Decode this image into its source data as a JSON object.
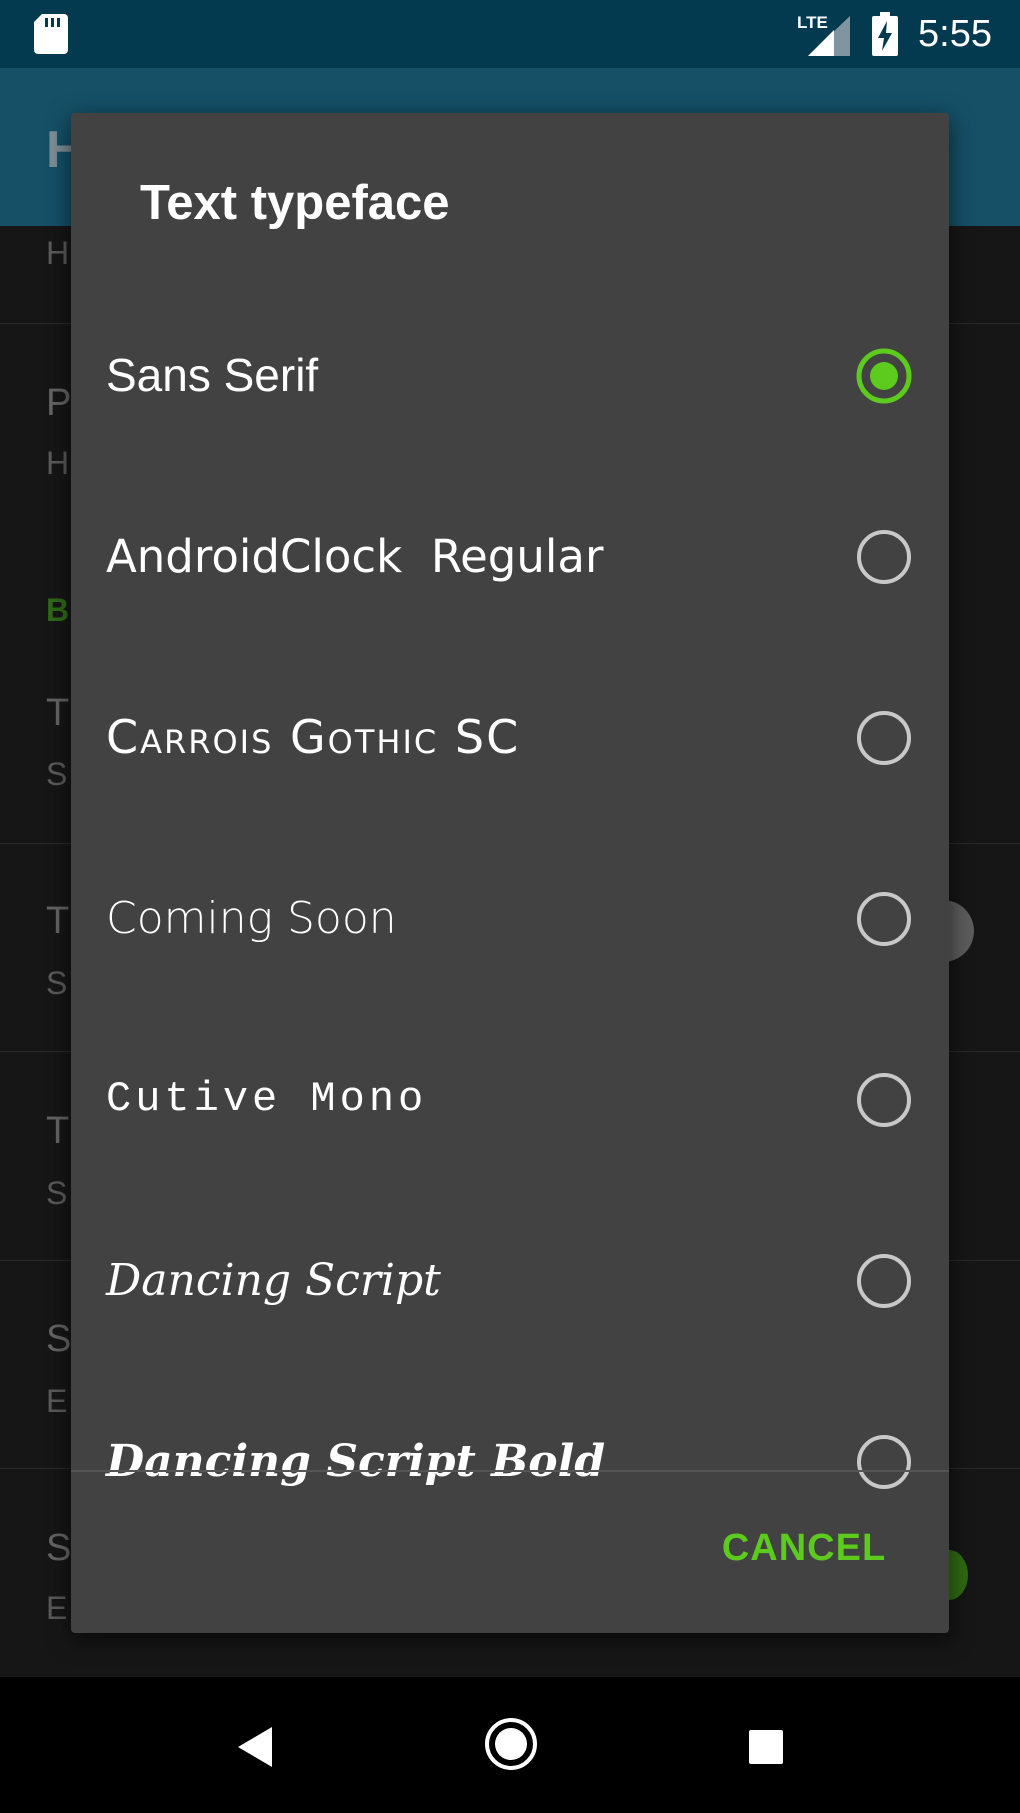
{
  "status_bar": {
    "network": "LTE",
    "time": "5:55",
    "icons": [
      "sd-card-icon",
      "signal-icon",
      "battery-charging-icon"
    ]
  },
  "app_bar": {
    "title_visible": "H"
  },
  "background_list": {
    "letters": [
      {
        "text": "H",
        "kind": "sub"
      },
      {
        "text": "P",
        "kind": "title"
      },
      {
        "text": "H",
        "kind": "sub"
      },
      {
        "text": "B",
        "kind": "cat"
      },
      {
        "text": "T",
        "kind": "title"
      },
      {
        "text": "S",
        "kind": "sub"
      },
      {
        "text": "T",
        "kind": "title"
      },
      {
        "text": "S",
        "kind": "sub"
      },
      {
        "text": "T",
        "kind": "title"
      },
      {
        "text": "S",
        "kind": "sub"
      },
      {
        "text": "S",
        "kind": "title"
      },
      {
        "text": "E",
        "kind": "sub"
      },
      {
        "text": "S",
        "kind": "title"
      },
      {
        "text": "E",
        "kind": "sub"
      }
    ]
  },
  "dialog": {
    "title": "Text typeface",
    "options": [
      {
        "label": "Sans Serif",
        "selected": true
      },
      {
        "label": "AndroidClock  Regular",
        "selected": false
      },
      {
        "label": "Carrois Gothic SC",
        "selected": false
      },
      {
        "label": "Coming Soon",
        "selected": false
      },
      {
        "label": "Cutive Mono",
        "selected": false
      },
      {
        "label": "Dancing Script",
        "selected": false
      },
      {
        "label": "Dancing Script Bold",
        "selected": false
      }
    ],
    "cancel_label": "CANCEL"
  },
  "colors": {
    "status_bar": "#033a50",
    "app_bar": "#155067",
    "dialog_bg": "#424242",
    "accent": "#5ccb1e",
    "radio_unselected": "#c8c8c8"
  }
}
